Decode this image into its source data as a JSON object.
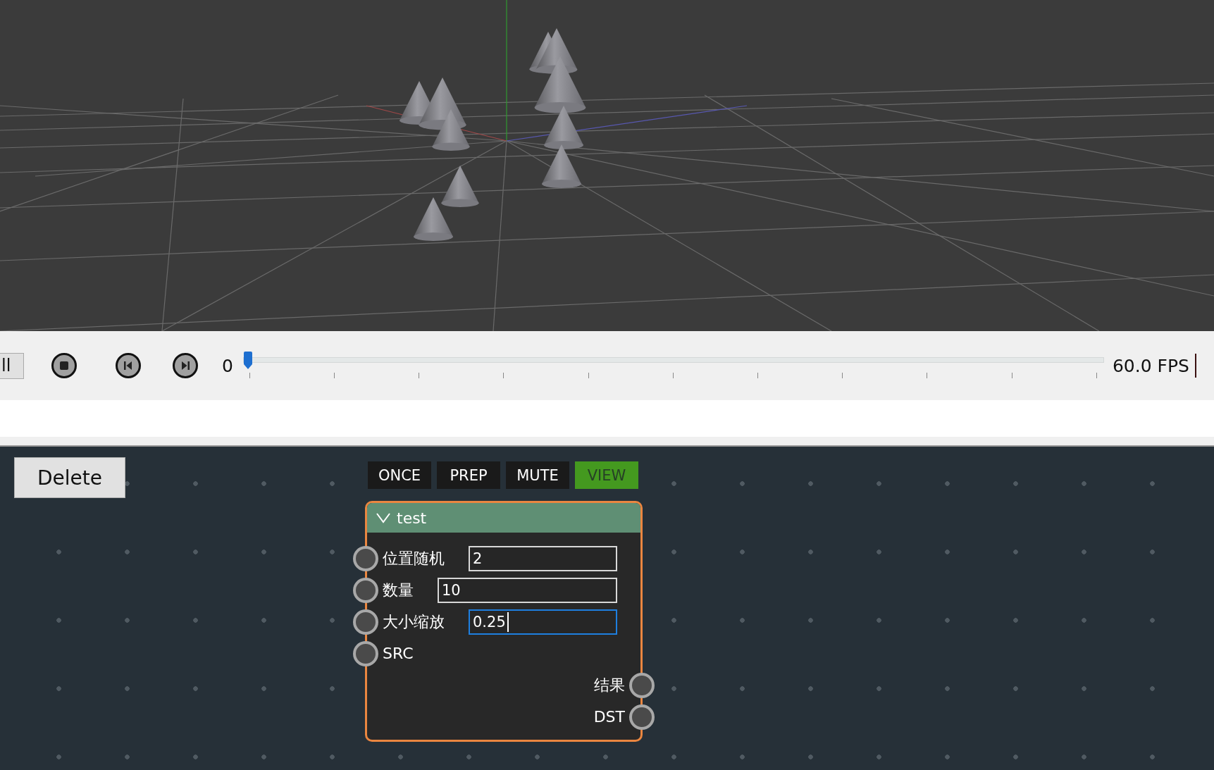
{
  "timeline": {
    "cut_button": "ll",
    "frame": "0",
    "level": 0,
    "fps": "60.0 FPS"
  },
  "delete_button": "Delete",
  "mode_buttons": [
    {
      "label": "ONCE",
      "selected": false
    },
    {
      "label": "PREP",
      "selected": false
    },
    {
      "label": "MUTE",
      "selected": false
    },
    {
      "label": "VIEW",
      "selected": true
    }
  ],
  "node": {
    "title": "test",
    "expanded": true,
    "selected": true,
    "inputs": [
      {
        "label": "位置随机",
        "value": "2",
        "focused": false
      },
      {
        "label": "数量",
        "value": "10",
        "focused": false
      },
      {
        "label": "大小缩放",
        "value": "0.25",
        "focused": true
      },
      {
        "label": "SRC"
      }
    ],
    "outputs": [
      {
        "label": "结果"
      },
      {
        "label": "DST"
      }
    ]
  }
}
